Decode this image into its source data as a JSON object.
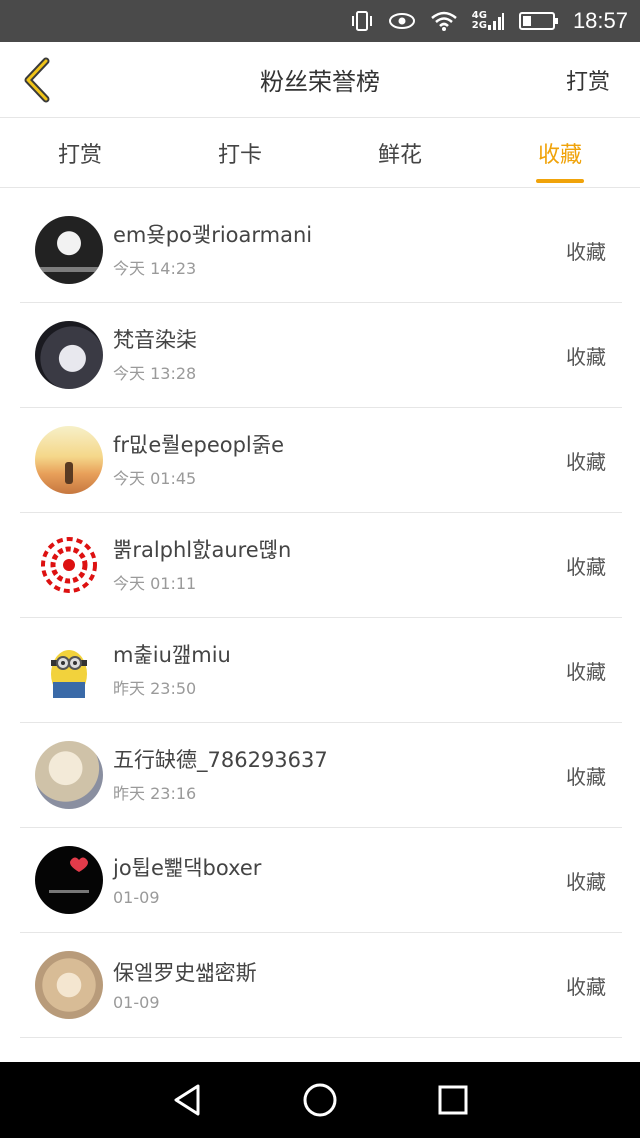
{
  "status_bar": {
    "network_top": "4G",
    "network_bottom": "2G",
    "time": "18:57"
  },
  "header": {
    "title": "粉丝荣誉榜",
    "action_label": "打赏",
    "back_icon": "chevron-left-icon",
    "accent_color": "#f0a30a"
  },
  "tabs": [
    {
      "label": "打赏",
      "active": false
    },
    {
      "label": "打卡",
      "active": false
    },
    {
      "label": "鲜花",
      "active": false
    },
    {
      "label": "收藏",
      "active": true
    }
  ],
  "list": [
    {
      "name": "em욪po괯rioarmani",
      "time": "今天 14:23",
      "action": "收藏"
    },
    {
      "name": "梵音染柒",
      "time": "今天 13:28",
      "action": "收藏"
    },
    {
      "name": "fr밊e뤌epeopl줅e",
      "time": "今天 01:45",
      "action": "收藏"
    },
    {
      "name": "뿕ralphl핤aure뗺n",
      "time": "今天 01:11",
      "action": "收藏"
    },
    {
      "name": "m춡iu깶miu",
      "time": "昨天 23:50",
      "action": "收藏"
    },
    {
      "name": "五行缺德_786293637",
      "time": "昨天 23:16",
      "action": "收藏"
    },
    {
      "name": "jo튑e뾅댁boxer",
      "time": "01-09",
      "action": "收藏"
    },
    {
      "name": "保엘罗史썗密斯",
      "time": "01-09",
      "action": "收藏"
    }
  ],
  "nav": {
    "back": "triangle-back-icon",
    "home": "circle-home-icon",
    "recent": "square-recent-icon"
  }
}
